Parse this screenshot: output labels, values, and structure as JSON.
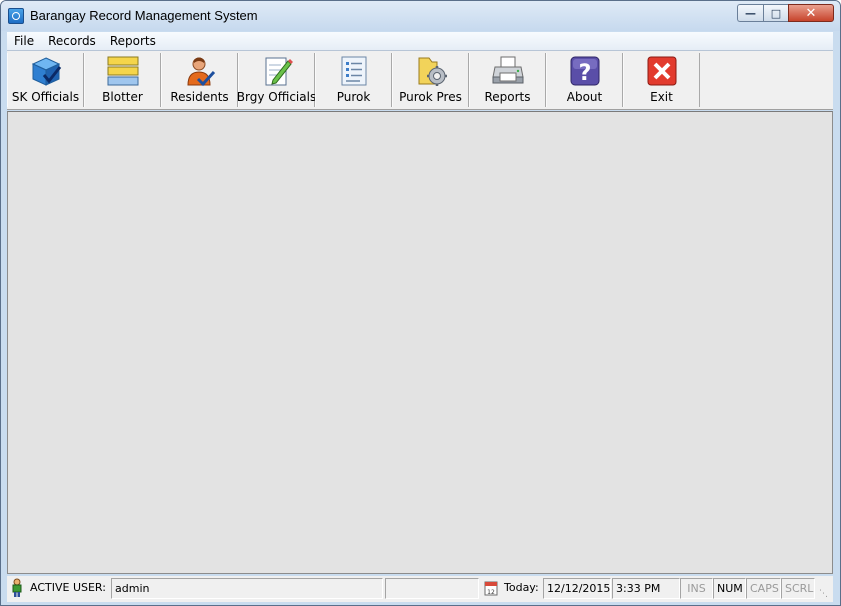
{
  "window": {
    "title": "Barangay Record Management System"
  },
  "menu": [
    "File",
    "Records",
    "Reports"
  ],
  "toolbar": [
    {
      "label": "SK Officials",
      "icon": "cube-check-icon"
    },
    {
      "label": "Blotter",
      "icon": "stacked-list-icon"
    },
    {
      "label": "Residents",
      "icon": "person-check-icon"
    },
    {
      "label": "Brgy Officials",
      "icon": "document-pen-icon"
    },
    {
      "label": "Purok",
      "icon": "list-document-icon"
    },
    {
      "label": "Purok Pres",
      "icon": "folder-gear-icon"
    },
    {
      "label": "Reports",
      "icon": "printer-icon"
    },
    {
      "label": "About",
      "icon": "question-mark-icon"
    },
    {
      "label": "Exit",
      "icon": "red-x-icon"
    }
  ],
  "status": {
    "active_user_label": "ACTIVE USER:",
    "active_user": "admin",
    "today_label": "Today:",
    "date": "12/12/2015",
    "time": "3:33 PM",
    "ins": "INS",
    "num": "NUM",
    "caps": "CAPS",
    "scrl": "SCRL"
  },
  "colors": {
    "frame": "#c9dcef",
    "workspace": "#e3e3e3",
    "close_button": "#c7432b"
  }
}
